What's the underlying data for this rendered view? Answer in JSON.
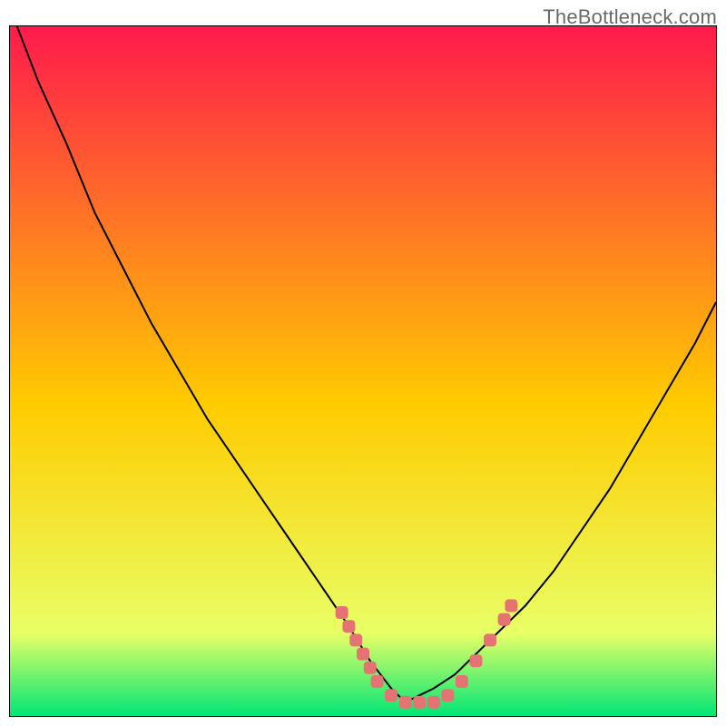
{
  "watermark": "TheBottleneck.com",
  "colors": {
    "gradient_top": "#ff1a4c",
    "gradient_mid": "#ffcc00",
    "gradient_bottom1": "#e8ff66",
    "gradient_bottom2": "#00e676",
    "curve": "#000000",
    "markers": "#e57373",
    "frame": "#000000"
  },
  "chart_data": {
    "type": "line",
    "title": "",
    "xlabel": "",
    "ylabel": "",
    "xlim": [
      0,
      100
    ],
    "ylim": [
      0,
      100
    ],
    "grid": false,
    "legend": null,
    "series": [
      {
        "name": "curve-left",
        "x": [
          1,
          4,
          8,
          12,
          16,
          20,
          24,
          28,
          32,
          36,
          40,
          44,
          48,
          51,
          54,
          56
        ],
        "values": [
          100,
          92,
          83,
          73,
          65,
          57,
          50,
          43,
          37,
          31,
          25,
          19,
          13,
          8,
          4,
          2
        ]
      },
      {
        "name": "curve-right",
        "x": [
          56,
          58,
          60,
          63,
          66,
          69,
          73,
          77,
          81,
          85,
          89,
          93,
          97,
          100
        ],
        "values": [
          2,
          3,
          4,
          6,
          9,
          12,
          16,
          21,
          27,
          33,
          40,
          47,
          54,
          60
        ]
      }
    ],
    "markers": {
      "name": "highlighted-points",
      "points": [
        {
          "x": 47,
          "y": 15
        },
        {
          "x": 48,
          "y": 13
        },
        {
          "x": 49,
          "y": 11
        },
        {
          "x": 50,
          "y": 9
        },
        {
          "x": 51,
          "y": 7
        },
        {
          "x": 52,
          "y": 5
        },
        {
          "x": 54,
          "y": 3
        },
        {
          "x": 56,
          "y": 2
        },
        {
          "x": 58,
          "y": 2
        },
        {
          "x": 60,
          "y": 2
        },
        {
          "x": 62,
          "y": 3
        },
        {
          "x": 64,
          "y": 5
        },
        {
          "x": 66,
          "y": 8
        },
        {
          "x": 68,
          "y": 11
        },
        {
          "x": 70,
          "y": 14
        },
        {
          "x": 71,
          "y": 16
        }
      ]
    }
  }
}
